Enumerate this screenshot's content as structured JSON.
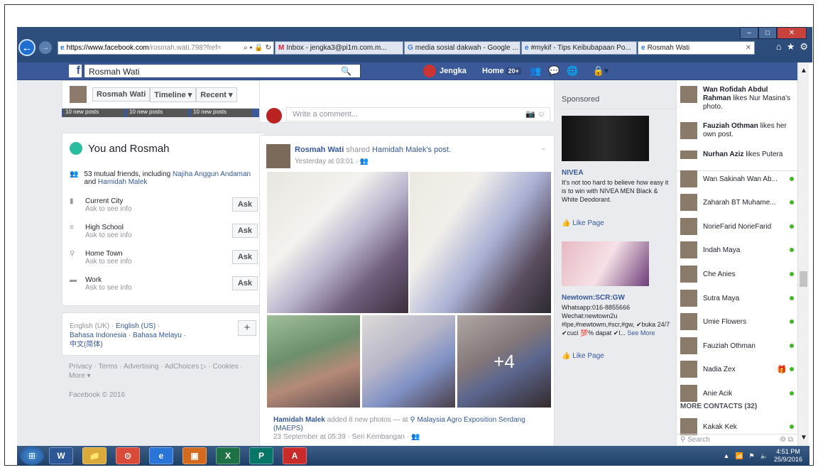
{
  "browser": {
    "url_domain": "https://www.facebook.com",
    "url_rest": "/rosmah.wati.798?fref=",
    "tabs": [
      {
        "icon": "gmail-icon",
        "label": "Inbox - jengka3@pi1m.com.m..."
      },
      {
        "icon": "google-icon",
        "label": "media sosial dakwah - Google ..."
      },
      {
        "icon": "ie-icon",
        "label": "#mykif - Tips Keibubapaan Po..."
      },
      {
        "icon": "ie-icon",
        "label": "Rosmah Wati"
      }
    ]
  },
  "fb": {
    "search_value": "Rosmah Wati",
    "user_name": "Jengka",
    "home_label": "Home",
    "home_badge": "20+"
  },
  "profile": {
    "name": "Rosmah Wati",
    "timeline_label": "Timeline ▾",
    "recent_label": "Recent ▾",
    "strip": [
      "10 new posts",
      "10 new posts",
      "10 new posts"
    ]
  },
  "intro": {
    "title": "You and Rosmah",
    "mutual_prefix": "53 mutual friends, including",
    "mutual_a": "Najiha Anggun Andaman",
    "mutual_and": "and",
    "mutual_b": "Hamidah Malek",
    "rows": [
      {
        "label": "Current City",
        "sub": "Ask to see info",
        "button": "Ask"
      },
      {
        "label": "High School",
        "sub": "Ask to see info",
        "button": "Ask"
      },
      {
        "label": "Home Town",
        "sub": "Ask to see info",
        "button": "Ask"
      },
      {
        "label": "Work",
        "sub": "Ask to see info",
        "button": "Ask"
      }
    ]
  },
  "languages": {
    "en_uk": "English (UK) ·",
    "en_us": "English (US)",
    "sep": "·",
    "id": "Bahasa Indonesia",
    "ms": "· Bahasa Melayu ·",
    "zh": "中文(简体)"
  },
  "footer": {
    "links": "Privacy · Terms · Advertising · AdChoices ▷ · Cookies · More ▾",
    "copyright": "Facebook © 2016"
  },
  "comment": {
    "placeholder": "Write a comment..."
  },
  "post": {
    "author": "Rosmah Wati",
    "action": "shared",
    "shared_from": "Hamidah Malek's post.",
    "time": "Yesterday at 03:01 · ",
    "more_photos": "+4",
    "caption_author": "Hamidah Malek",
    "caption_action": "added 8 new photos — at",
    "caption_place": "Malaysia Agro Exposition Serdang (MAEPS)",
    "caption_time": "23 September at 05:39 · Seri Kembangan · "
  },
  "sponsored": {
    "header": "Sponsored",
    "ads": [
      {
        "title": "NIVEA",
        "body": "It's not too hard to believe how easy it is to win with NIVEA MEN Black & White Deodorant.",
        "like": "Like Page"
      },
      {
        "title": "Newtown:SCR:GW",
        "body": "Whatsapp:016-8855666 Wechat:newtown2u #lpe,#newtowm,#scr,#gw, ✔buka 24/7 ✔cuci 💯% dapat ✔l...",
        "see_more": "See More",
        "like": "Like Page"
      }
    ]
  },
  "activity": [
    {
      "name": "Wan Rofidah Abdul Rahman",
      "text": "likes Nur Masina's photo."
    },
    {
      "name": "Fauziah Othman",
      "text": "likes her own post."
    },
    {
      "name": "Nurhan Aziz",
      "text": "likes Putera"
    }
  ],
  "contacts": [
    {
      "name": "Wan Sakinah Wan Ab...",
      "status": "online"
    },
    {
      "name": "Zaharah BT Muhame...",
      "status": "online"
    },
    {
      "name": "NorieFarid NorieFarid",
      "status": "online"
    },
    {
      "name": "Indah Maya",
      "status": "online"
    },
    {
      "name": "Che Anies",
      "status": "online"
    },
    {
      "name": "Sutra Maya",
      "status": "online"
    },
    {
      "name": "Umie Flowers",
      "status": "online"
    },
    {
      "name": "Fauziah Othman",
      "status": "online"
    },
    {
      "name": "Nadia Zex",
      "status": "online"
    },
    {
      "name": "Anie Acik",
      "status": "online"
    }
  ],
  "more_contacts": "MORE CONTACTS (32)",
  "more_contact_list": [
    {
      "name": "Kakak Kek",
      "status": "online"
    }
  ],
  "chat_search_placeholder": "Search",
  "taskbar": {
    "apps": [
      "W",
      "📁",
      "⊙",
      "e",
      "▣",
      "X",
      "P",
      "A"
    ],
    "time": "4:51 PM",
    "date": "25/9/2016"
  }
}
